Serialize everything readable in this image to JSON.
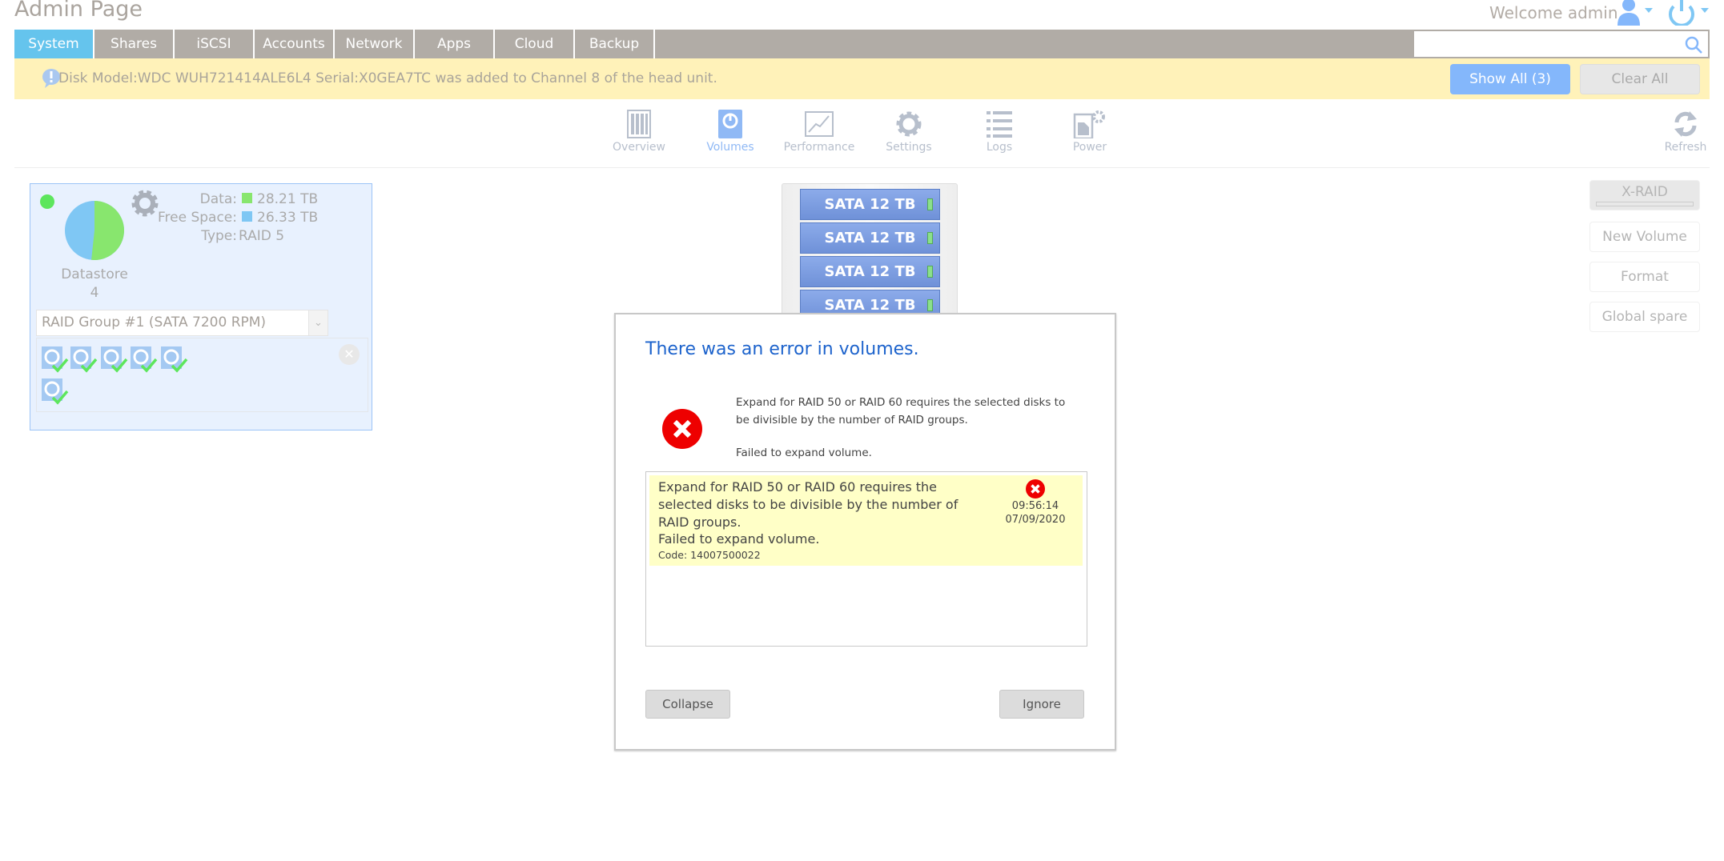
{
  "header": {
    "title": "Admin Page",
    "welcome": "Welcome admin"
  },
  "tabs": [
    "System",
    "Shares",
    "iSCSI",
    "Accounts",
    "Network",
    "Apps",
    "Cloud",
    "Backup"
  ],
  "search": {
    "placeholder": ""
  },
  "notification": {
    "text": "Disk Model:WDC WUH721414ALE6L4 Serial:X0GEA7TC was added to Channel 8 of the head unit.",
    "show_all": "Show All (3)",
    "clear_all": "Clear All"
  },
  "nav": [
    "Overview",
    "Volumes",
    "Performance",
    "Settings",
    "Logs",
    "Power"
  ],
  "refresh": "Refresh",
  "volume": {
    "data_label": "Data:",
    "data_value": "28.21 TB",
    "free_label": "Free Space:",
    "free_value": "26.33 TB",
    "type_label": "Type:",
    "type_value": "RAID 5",
    "name": "Datastore",
    "number": "4",
    "raid_group": "RAID Group #1 (SATA 7200 RPM)",
    "data_fraction": 0.517,
    "colors": {
      "data": "#88e66e",
      "free": "#7fc7f4"
    }
  },
  "rack": {
    "bays": [
      "SATA 12 TB",
      "SATA 12 TB",
      "SATA 12 TB",
      "SATA 12 TB"
    ]
  },
  "actions": {
    "xraid": "X-RAID",
    "new_volume": "New Volume",
    "format": "Format",
    "global_spare": "Global spare"
  },
  "dialog": {
    "title": "There was an error in volumes.",
    "message": "Expand for RAID 50 or RAID 60 requires the selected disks to be divisible by the number of RAID groups.",
    "failed": "Failed to expand volume.",
    "log": {
      "message": "Expand for RAID 50 or RAID 60 requires the selected disks to be divisible by the number of RAID groups.",
      "failed": "Failed to expand volume.",
      "code": "Code: 14007500022",
      "time": "09:56:14",
      "date": "07/09/2020"
    },
    "collapse": "Collapse",
    "ignore": "Ignore"
  }
}
